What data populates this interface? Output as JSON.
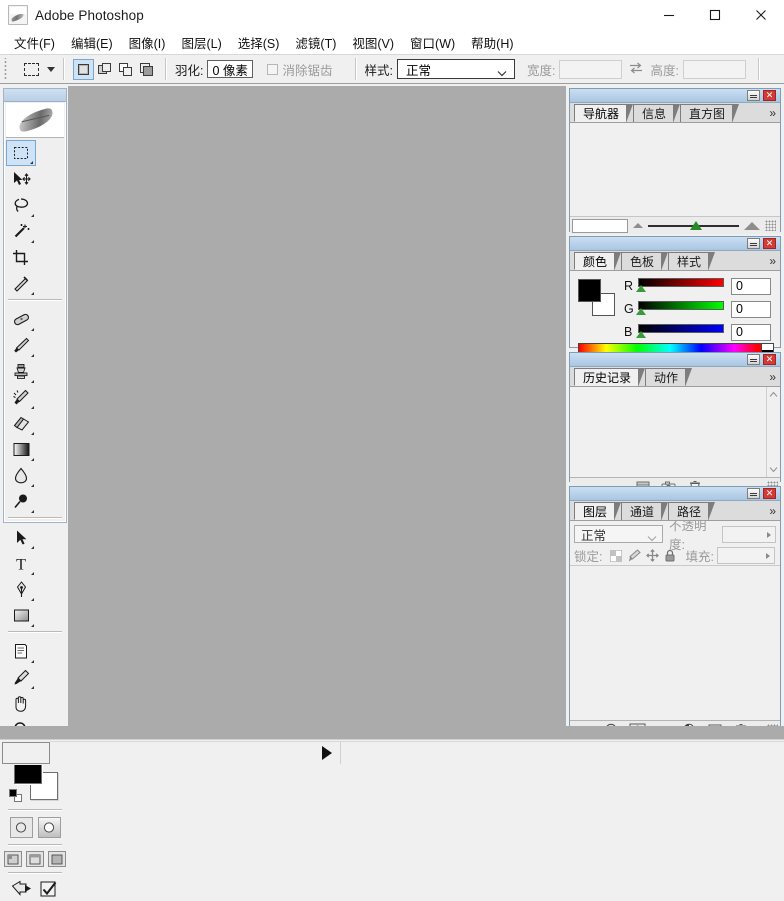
{
  "window": {
    "title": "Adobe Photoshop",
    "logo_icon": "photoshop-feather-icon",
    "minimize_label": "—",
    "maximize_label": "□",
    "close_label": "✕"
  },
  "menubar": {
    "items": [
      {
        "label": "文件(F)",
        "name": "menu-file"
      },
      {
        "label": "编辑(E)",
        "name": "menu-edit"
      },
      {
        "label": "图像(I)",
        "name": "menu-image"
      },
      {
        "label": "图层(L)",
        "name": "menu-layer"
      },
      {
        "label": "选择(S)",
        "name": "menu-select"
      },
      {
        "label": "滤镜(T)",
        "name": "menu-filter"
      },
      {
        "label": "视图(V)",
        "name": "menu-view"
      },
      {
        "label": "窗口(W)",
        "name": "menu-window"
      },
      {
        "label": "帮助(H)",
        "name": "menu-help"
      }
    ]
  },
  "options_bar": {
    "tool_preset_icon": "rectangular-marquee-icon",
    "selection_modes": [
      {
        "name": "new-selection-mode",
        "active": true
      },
      {
        "name": "add-to-selection-mode",
        "active": false
      },
      {
        "name": "subtract-from-selection-mode",
        "active": false
      },
      {
        "name": "intersect-selection-mode",
        "active": false
      }
    ],
    "feather_label": "羽化:",
    "feather_value": "0 像素",
    "antialias_label": "消除锯齿",
    "antialias_checked": false,
    "style_label": "样式:",
    "style_value": "正常",
    "width_label": "宽度:",
    "width_value": "",
    "swap_icon": "swap-width-height-icon",
    "height_label": "高度:",
    "height_value": ""
  },
  "toolbox": {
    "logo_icon": "photoshop-feather-logo",
    "tools": [
      {
        "name": "tool-rectangular-marquee",
        "icon": "marquee-icon",
        "active": true
      },
      {
        "name": "tool-move",
        "icon": "move-icon",
        "active": false
      },
      {
        "name": "tool-lasso",
        "icon": "lasso-icon",
        "active": false
      },
      {
        "name": "tool-magic-wand",
        "icon": "magic-wand-icon",
        "active": false
      },
      {
        "name": "tool-crop",
        "icon": "crop-icon",
        "active": false
      },
      {
        "name": "tool-slice",
        "icon": "slice-icon",
        "active": false
      },
      {
        "name": "tool-healing-brush",
        "icon": "healing-brush-icon",
        "active": false
      },
      {
        "name": "tool-brush",
        "icon": "brush-icon",
        "active": false
      },
      {
        "name": "tool-clone-stamp",
        "icon": "clone-stamp-icon",
        "active": false
      },
      {
        "name": "tool-history-brush",
        "icon": "history-brush-icon",
        "active": false
      },
      {
        "name": "tool-eraser",
        "icon": "eraser-icon",
        "active": false
      },
      {
        "name": "tool-gradient",
        "icon": "gradient-icon",
        "active": false
      },
      {
        "name": "tool-blur",
        "icon": "blur-drop-icon",
        "active": false
      },
      {
        "name": "tool-dodge",
        "icon": "dodge-icon",
        "active": false
      },
      {
        "name": "tool-path-selection",
        "icon": "path-arrow-icon",
        "active": false
      },
      {
        "name": "tool-type",
        "icon": "type-t-icon",
        "active": false
      },
      {
        "name": "tool-pen",
        "icon": "pen-icon",
        "active": false
      },
      {
        "name": "tool-rectangle-shape",
        "icon": "rectangle-shape-icon",
        "active": false
      },
      {
        "name": "tool-notes",
        "icon": "notes-icon",
        "active": false
      },
      {
        "name": "tool-eyedropper",
        "icon": "eyedropper-icon",
        "active": false
      },
      {
        "name": "tool-hand",
        "icon": "hand-icon",
        "active": false
      },
      {
        "name": "tool-zoom",
        "icon": "zoom-magnifier-icon",
        "active": false
      }
    ],
    "foreground_color": "#000000",
    "background_color": "#ffffff",
    "swap_colors_icon": "swap-colors-icon",
    "default_colors_icon": "default-colors-icon",
    "quickmask_modes": [
      {
        "name": "standard-mode-button",
        "icon": "standard-mode-icon",
        "selected": false
      },
      {
        "name": "quick-mask-mode-button",
        "icon": "quick-mask-icon",
        "selected": true
      }
    ],
    "screen_modes": [
      {
        "name": "standard-screen-mode",
        "icon": "standard-screen-icon"
      },
      {
        "name": "full-screen-with-menubar",
        "icon": "fullscreen-menubar-icon"
      },
      {
        "name": "full-screen-mode",
        "icon": "fullscreen-icon"
      }
    ],
    "jump_buttons": [
      {
        "name": "jump-to-imageready-button",
        "icon": "jump-to-icon"
      },
      {
        "name": "imageready-check-button",
        "icon": "imageready-check-icon"
      }
    ]
  },
  "panels": {
    "navigator": {
      "tabs": [
        {
          "label": "导航器",
          "name": "tab-navigator",
          "selected": true
        },
        {
          "label": "信息",
          "name": "tab-info",
          "selected": false
        },
        {
          "label": "直方图",
          "name": "tab-histogram",
          "selected": false
        }
      ],
      "menu_icon": "panel-menu-icon",
      "zoom_value": "",
      "zoom_out_icon": "zoom-out-mountain-icon",
      "zoom_in_icon": "zoom-in-mountain-icon",
      "minimize_icon": "panel-minimize-icon",
      "close_icon": "panel-close-icon"
    },
    "color": {
      "tabs": [
        {
          "label": "颜色",
          "name": "tab-color",
          "selected": true
        },
        {
          "label": "色板",
          "name": "tab-swatches",
          "selected": false
        },
        {
          "label": "样式",
          "name": "tab-styles",
          "selected": false
        }
      ],
      "menu_icon": "panel-menu-icon",
      "foreground_color": "#000000",
      "background_color": "#ffffff",
      "channels": [
        {
          "label": "R",
          "value": "0",
          "name": "color-slider-r"
        },
        {
          "label": "G",
          "value": "0",
          "name": "color-slider-g"
        },
        {
          "label": "B",
          "value": "0",
          "name": "color-slider-b"
        }
      ],
      "spectrum_icon": "color-spectrum-ramp"
    },
    "history": {
      "tabs": [
        {
          "label": "历史记录",
          "name": "tab-history",
          "selected": true
        },
        {
          "label": "动作",
          "name": "tab-actions",
          "selected": false
        }
      ],
      "menu_icon": "panel-menu-icon",
      "footer_icons": [
        {
          "name": "new-document-from-state-button",
          "icon": "new-document-icon"
        },
        {
          "name": "new-snapshot-button",
          "icon": "camera-icon"
        },
        {
          "name": "delete-state-button",
          "icon": "trash-icon"
        }
      ]
    },
    "layers": {
      "tabs": [
        {
          "label": "图层",
          "name": "tab-layers",
          "selected": true
        },
        {
          "label": "通道",
          "name": "tab-channels",
          "selected": false
        },
        {
          "label": "路径",
          "name": "tab-paths",
          "selected": false
        }
      ],
      "menu_icon": "panel-menu-icon",
      "blend_mode": "正常",
      "opacity_label": "不透明度:",
      "opacity_value": "",
      "lock_label": "锁定:",
      "lock_icons": [
        {
          "name": "lock-transparency-icon",
          "icon": "checkerboard-icon"
        },
        {
          "name": "lock-image-pixels-icon",
          "icon": "brush-icon"
        },
        {
          "name": "lock-position-icon",
          "icon": "move-cross-icon"
        },
        {
          "name": "lock-all-icon",
          "icon": "padlock-icon"
        }
      ],
      "fill_label": "填充:",
      "fill_value": "",
      "footer_icons": [
        {
          "name": "layer-style-button",
          "icon": "fx-icon"
        },
        {
          "name": "add-layer-mask-button",
          "icon": "layer-mask-icon"
        },
        {
          "name": "new-group-button",
          "icon": "folder-icon"
        },
        {
          "name": "new-adjustment-layer-button",
          "icon": "adjustment-circle-icon"
        },
        {
          "name": "new-layer-button",
          "icon": "new-layer-icon"
        },
        {
          "name": "delete-layer-button",
          "icon": "trash-icon"
        }
      ]
    }
  },
  "statusbar": {
    "field_value": "",
    "expand_icon": "play-triangle-icon"
  },
  "colors": {
    "workspace_gray": "#ababab",
    "panel_bg": "#f0f0f0",
    "panel_titlebar": "#b9cfe6",
    "active_tool_highlight": "#cfe3f7",
    "close_button_red": "#d63a34"
  }
}
